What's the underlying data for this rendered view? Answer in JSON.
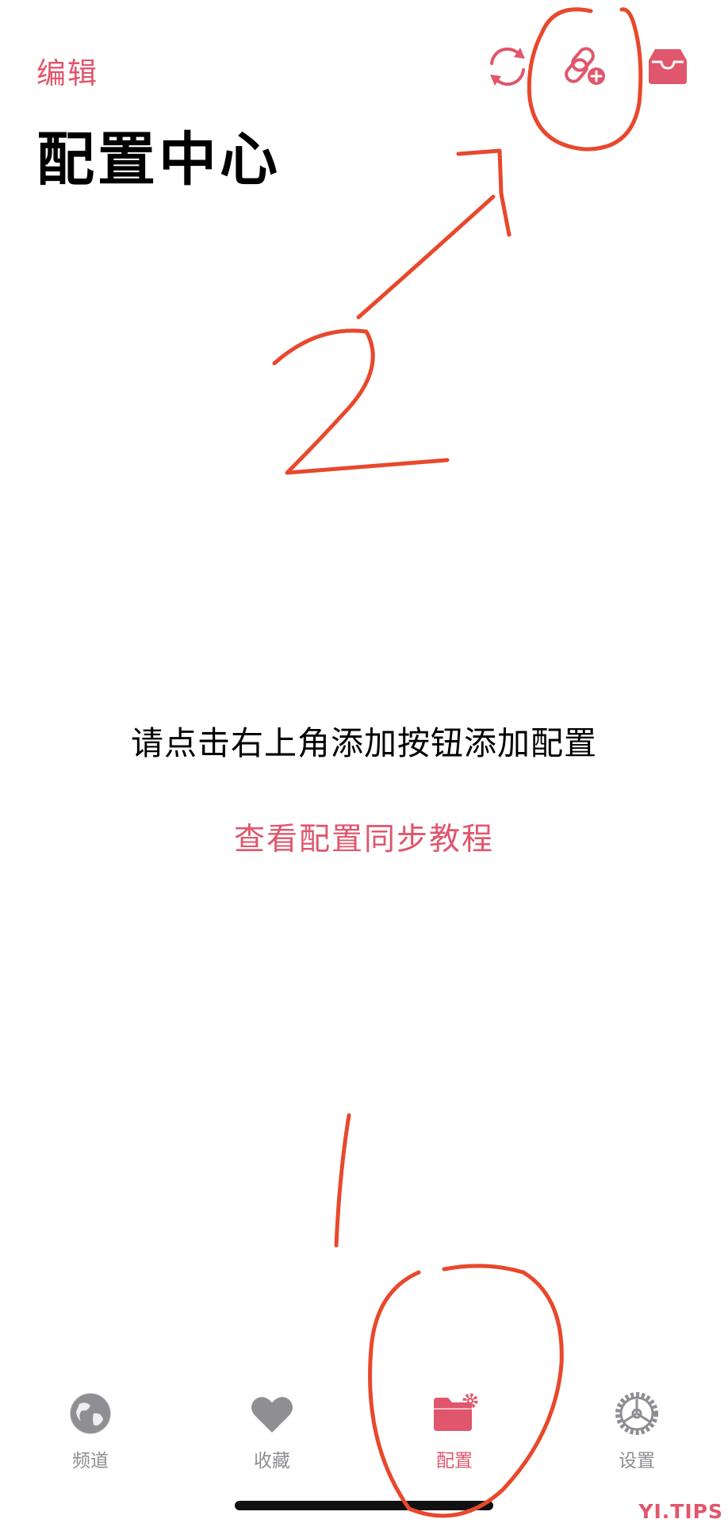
{
  "header": {
    "edit_label": "编辑",
    "title": "配置中心",
    "icons": [
      "sync-icon",
      "link-add-icon",
      "inbox-icon"
    ]
  },
  "main": {
    "empty_message": "请点击右上角添加按钮添加配置",
    "tutorial_link": "查看配置同步教程"
  },
  "tabbar": {
    "items": [
      {
        "label": "频道",
        "icon": "globe-icon",
        "active": false
      },
      {
        "label": "收藏",
        "icon": "heart-icon",
        "active": false
      },
      {
        "label": "配置",
        "icon": "folder-gear-icon",
        "active": true
      },
      {
        "label": "设置",
        "icon": "gear-icon",
        "active": false
      }
    ]
  },
  "annotations": {
    "step_top": "2",
    "step_bottom": "1"
  },
  "watermark": "YI.TIPS",
  "colors": {
    "accent": "#e0566c",
    "inactive": "#8e8e93",
    "annotation": "#e8482c"
  }
}
